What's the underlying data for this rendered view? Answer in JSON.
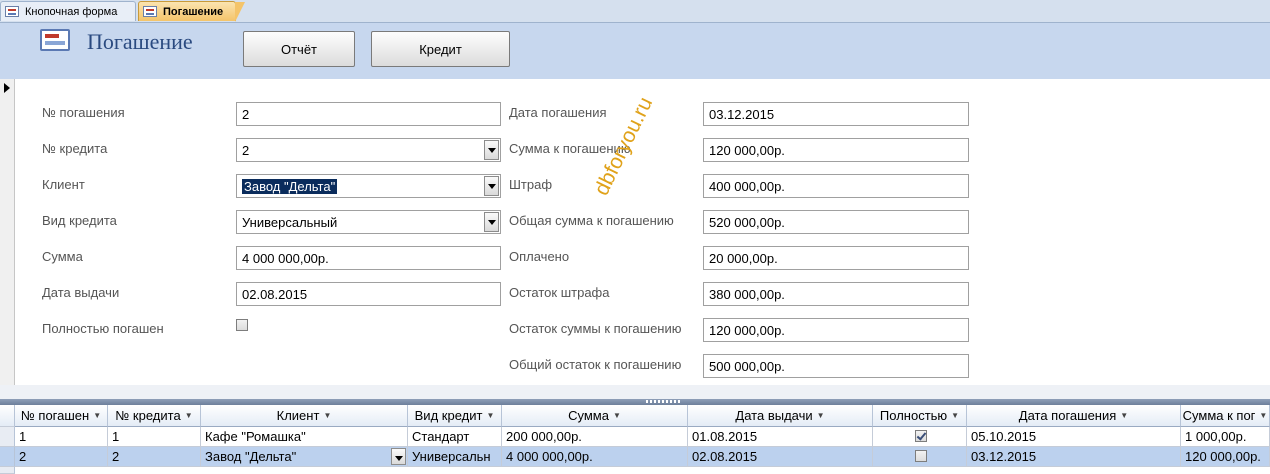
{
  "tabs": [
    {
      "label": "Кнопочная форма",
      "active": false
    },
    {
      "label": "Погашение",
      "active": true
    }
  ],
  "header": {
    "title": "Погашение",
    "report_button": "Отчёт",
    "credit_button": "Кредит"
  },
  "form": {
    "left": [
      {
        "label": "№ погашения",
        "value": "2",
        "type": "text"
      },
      {
        "label": "№ кредита",
        "value": "2",
        "type": "combo"
      },
      {
        "label": "Клиент",
        "value": "Завод \"Дельта\"",
        "type": "combo"
      },
      {
        "label": "Вид кредита",
        "value": "Универсальный",
        "type": "combo"
      },
      {
        "label": "Сумма",
        "value": "4 000 000,00р.",
        "type": "text"
      },
      {
        "label": "Дата выдачи",
        "value": "02.08.2015",
        "type": "text"
      }
    ],
    "paid_off_label": "Полностью погашен",
    "paid_off_checked": false,
    "right": [
      {
        "label": "Дата погашения",
        "value": "03.12.2015"
      },
      {
        "label": "Сумма к погашению",
        "value": "120 000,00р."
      },
      {
        "label": "Штраф",
        "value": "400 000,00р."
      },
      {
        "label": "Общая сумма к погашению",
        "value": "520 000,00р."
      },
      {
        "label": "Оплачено",
        "value": "20 000,00р."
      },
      {
        "label": "Остаток штрафа",
        "value": "380 000,00р."
      },
      {
        "label": "Остаток суммы к погашению",
        "value": "120 000,00р."
      },
      {
        "label": "Общий остаток к погашению",
        "value": "500 000,00р."
      }
    ]
  },
  "watermark": "dbforyou.ru",
  "datasheet": {
    "columns": [
      "№ погашен",
      "№ кредита",
      "Клиент",
      "Вид кредит",
      "Сумма",
      "Дата выдачи",
      "Полностью",
      "Дата погашения",
      "Сумма к пог"
    ],
    "rows": [
      {
        "cells": [
          "1",
          "1",
          "Кафе \"Ромашка\"",
          "Стандарт",
          "200 000,00р.",
          "01.08.2015",
          "",
          "05.10.2015",
          "1 000,00р."
        ],
        "checked": true
      },
      {
        "cells": [
          "2",
          "2",
          "Завод \"Дельта\"",
          "Универсальн",
          "4 000 000,00р.",
          "02.08.2015",
          "",
          "03.12.2015",
          "120 000,00р."
        ],
        "checked": false
      }
    ]
  }
}
